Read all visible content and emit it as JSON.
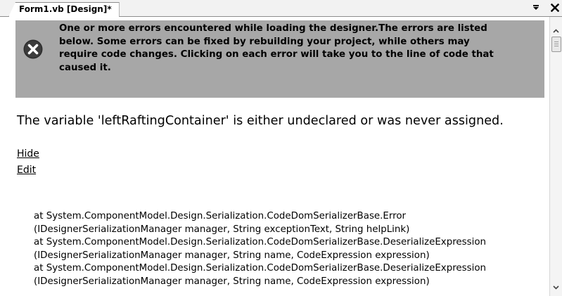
{
  "tab": {
    "title": "Form1.vb [Design]*"
  },
  "toolbar": {
    "dropdown_icon": "dropdown-arrow-icon",
    "close_label": "✕"
  },
  "error_banner": {
    "icon": "error-x-icon",
    "text_lines": [
      "One or more errors encountered while loading the designer.The errors are listed",
      "below. Some errors can be fixed by rebuilding your project, while others may",
      "require code changes. Clicking on each error will take you to the line of code that",
      "caused it."
    ],
    "background": "#a7a7a7"
  },
  "error": {
    "message": "The variable 'leftRaftingContainer' is either undeclared or was never assigned."
  },
  "links": {
    "hide": "Hide",
    "edit": "Edit"
  },
  "stack_trace": [
    "at System.ComponentModel.Design.Serialization.CodeDomSerializerBase.Error",
    "(IDesignerSerializationManager manager, String exceptionText, String helpLink)",
    "at System.ComponentModel.Design.Serialization.CodeDomSerializerBase.DeserializeExpression",
    "(IDesignerSerializationManager manager, String name, CodeExpression expression)",
    "at System.ComponentModel.Design.Serialization.CodeDomSerializerBase.DeserializeExpression",
    "(IDesignerSerializationManager manager, String name, CodeExpression expression)"
  ],
  "scrollbar": {
    "up_icon": "scroll-up-arrow-icon",
    "down_icon": "scroll-down-arrow-icon"
  }
}
